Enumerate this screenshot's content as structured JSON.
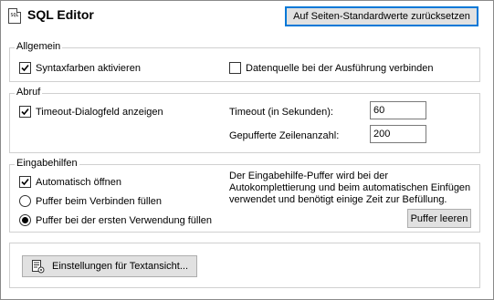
{
  "header": {
    "title": "SQL Editor",
    "icon_text": "SQL",
    "reset_button": "Auf Seiten-Standardwerte zurücksetzen"
  },
  "general": {
    "label": "Allgemein",
    "syntax_colors": {
      "label": "Syntaxfarben aktivieren",
      "checked": true
    },
    "connect_datasource": {
      "label": "Datenquelle bei der Ausführung verbinden",
      "checked": false
    }
  },
  "retrieval": {
    "label": "Abruf",
    "timeout_dialog": {
      "label": "Timeout-Dialogfeld anzeigen",
      "checked": true
    },
    "timeout_label": "Timeout (in Sekunden):",
    "timeout_value": "60",
    "buffered_rows_label": "Gepufferte Zeilenanzahl:",
    "buffered_rows_value": "200"
  },
  "entry_helpers": {
    "label": "Eingabehilfen",
    "auto_open": {
      "label": "Automatisch öffnen",
      "checked": true
    },
    "fill_on_connect": {
      "label": "Puffer beim Verbinden füllen",
      "selected": false
    },
    "fill_on_first_use": {
      "label": "Puffer bei der ersten Verwendung füllen",
      "selected": true
    },
    "description": "Der Eingabehilfe-Puffer wird bei der Autokomplettierung und beim automatischen Einfügen verwendet und benötigt einige Zeit zur Befüllung.",
    "clear_buffer_button": "Puffer leeren"
  },
  "text_view": {
    "button": "Einstellungen für Textansicht..."
  },
  "colors": {
    "focus": "#0078d7",
    "button_bg": "#e1e1e1",
    "group_border": "#d0d0d0"
  }
}
